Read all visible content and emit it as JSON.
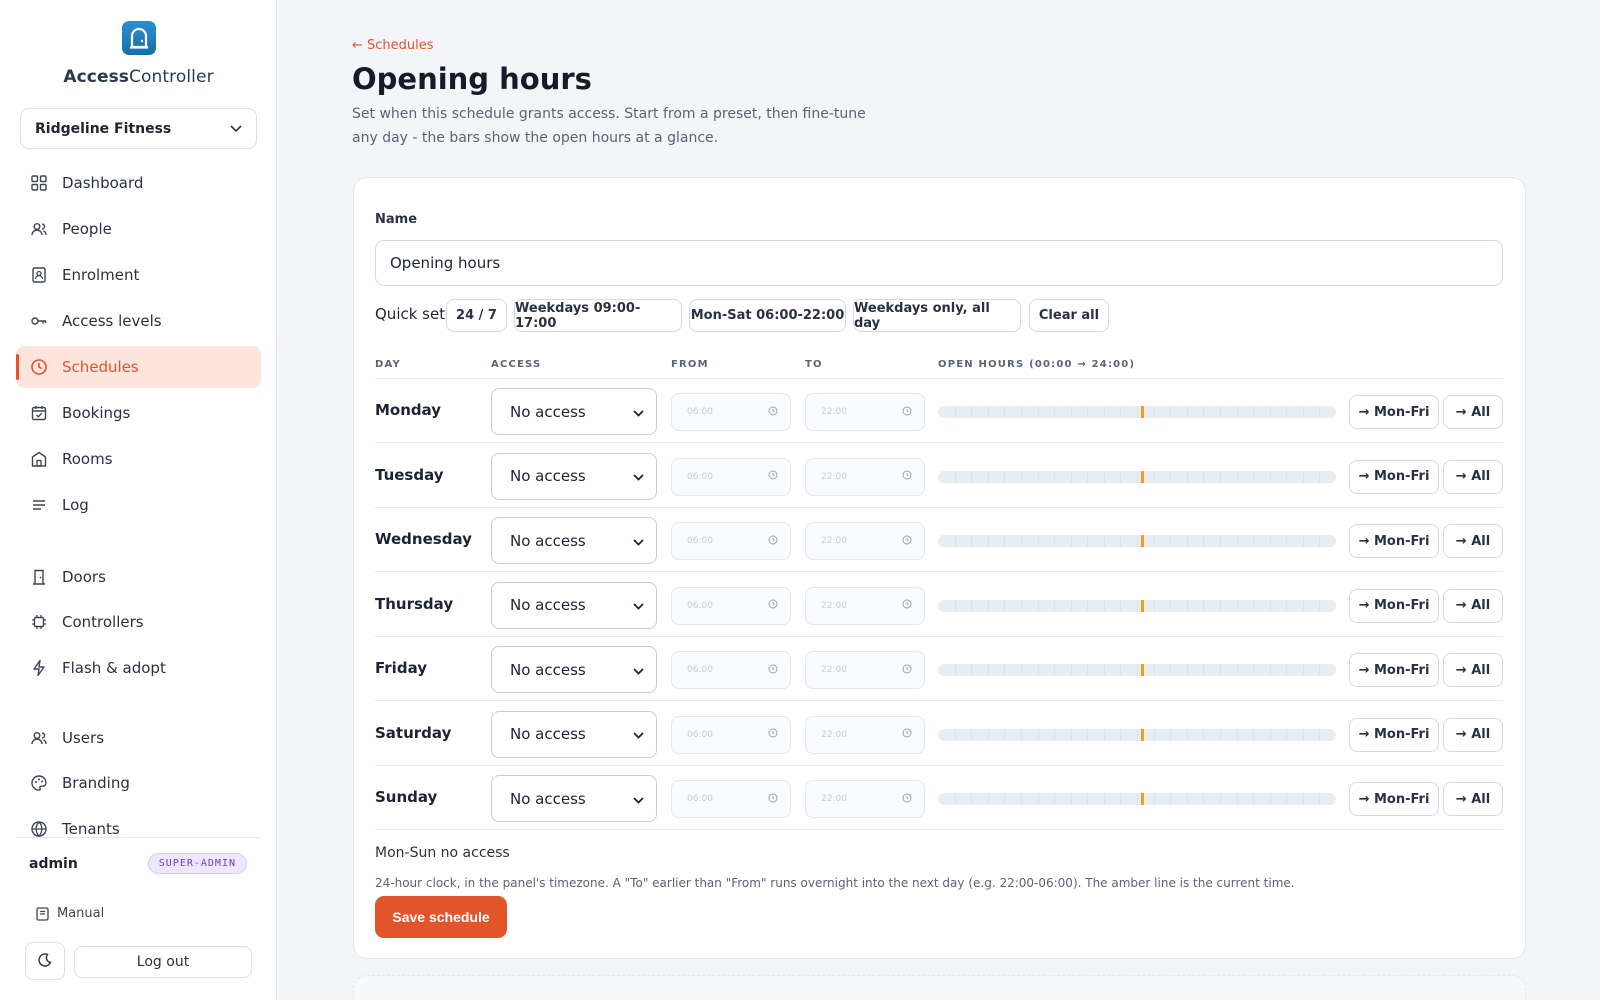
{
  "app": {
    "name_bold": "Access",
    "name_rest": "Controller",
    "tenant": "Ridgeline Fitness"
  },
  "nav": [
    {
      "label": "Dashboard",
      "icon": "dashboard-icon"
    },
    {
      "label": "People",
      "icon": "people-icon"
    },
    {
      "label": "Enrolment",
      "icon": "enrolment-icon"
    },
    {
      "label": "Access levels",
      "icon": "key-icon"
    },
    {
      "label": "Schedules",
      "icon": "clock-icon",
      "active": true
    },
    {
      "label": "Bookings",
      "icon": "calendar-icon"
    },
    {
      "label": "Rooms",
      "icon": "room-icon"
    },
    {
      "label": "Log",
      "icon": "list-icon"
    },
    {
      "label": "Doors",
      "icon": "door-icon"
    },
    {
      "label": "Controllers",
      "icon": "chip-icon"
    },
    {
      "label": "Flash & adopt",
      "icon": "bolt-icon"
    },
    {
      "label": "Users",
      "icon": "users-icon"
    },
    {
      "label": "Branding",
      "icon": "palette-icon"
    },
    {
      "label": "Tenants",
      "icon": "tenants-icon"
    }
  ],
  "user": {
    "name": "admin",
    "role": "SUPER-ADMIN"
  },
  "footer": {
    "manual": "Manual",
    "logout": "Log out"
  },
  "page": {
    "back": "← Schedules",
    "title": "Opening hours",
    "description": "Set when this schedule grants access. Start from a preset, then fine-tune any day - the bars show the open hours at a glance."
  },
  "form": {
    "name_label": "Name",
    "name_value": "Opening hours",
    "quick_label": "Quick set",
    "quick": [
      "24 / 7",
      "Weekdays 09:00-17:00",
      "Mon-Sat 06:00-22:00",
      "Weekdays only, all day",
      "Clear all"
    ],
    "columns": {
      "day": "DAY",
      "access": "ACCESS",
      "from": "FROM",
      "to": "TO",
      "hours": "OPEN HOURS (00:00 → 24:00)"
    },
    "from_placeholder": "06:00",
    "to_placeholder": "22:00",
    "copy_weekdays": "→ Mon-Fri",
    "copy_all": "→ All",
    "days": [
      {
        "name": "Monday",
        "access": "No access"
      },
      {
        "name": "Tuesday",
        "access": "No access"
      },
      {
        "name": "Wednesday",
        "access": "No access"
      },
      {
        "name": "Thursday",
        "access": "No access"
      },
      {
        "name": "Friday",
        "access": "No access"
      },
      {
        "name": "Saturday",
        "access": "No access"
      },
      {
        "name": "Sunday",
        "access": "No access"
      }
    ],
    "current_time_fraction": 0.51,
    "summary": "Mon-Sun no access",
    "help": "24-hour clock, in the panel's timezone. A \"To\" earlier than \"From\" runs overnight into the next day (e.g. 22:00-06:00). The amber line is the current time.",
    "save": "Save schedule"
  },
  "colors": {
    "accent": "#e2542a",
    "now_marker": "#f0a020",
    "active_bg": "#fde5dd"
  }
}
